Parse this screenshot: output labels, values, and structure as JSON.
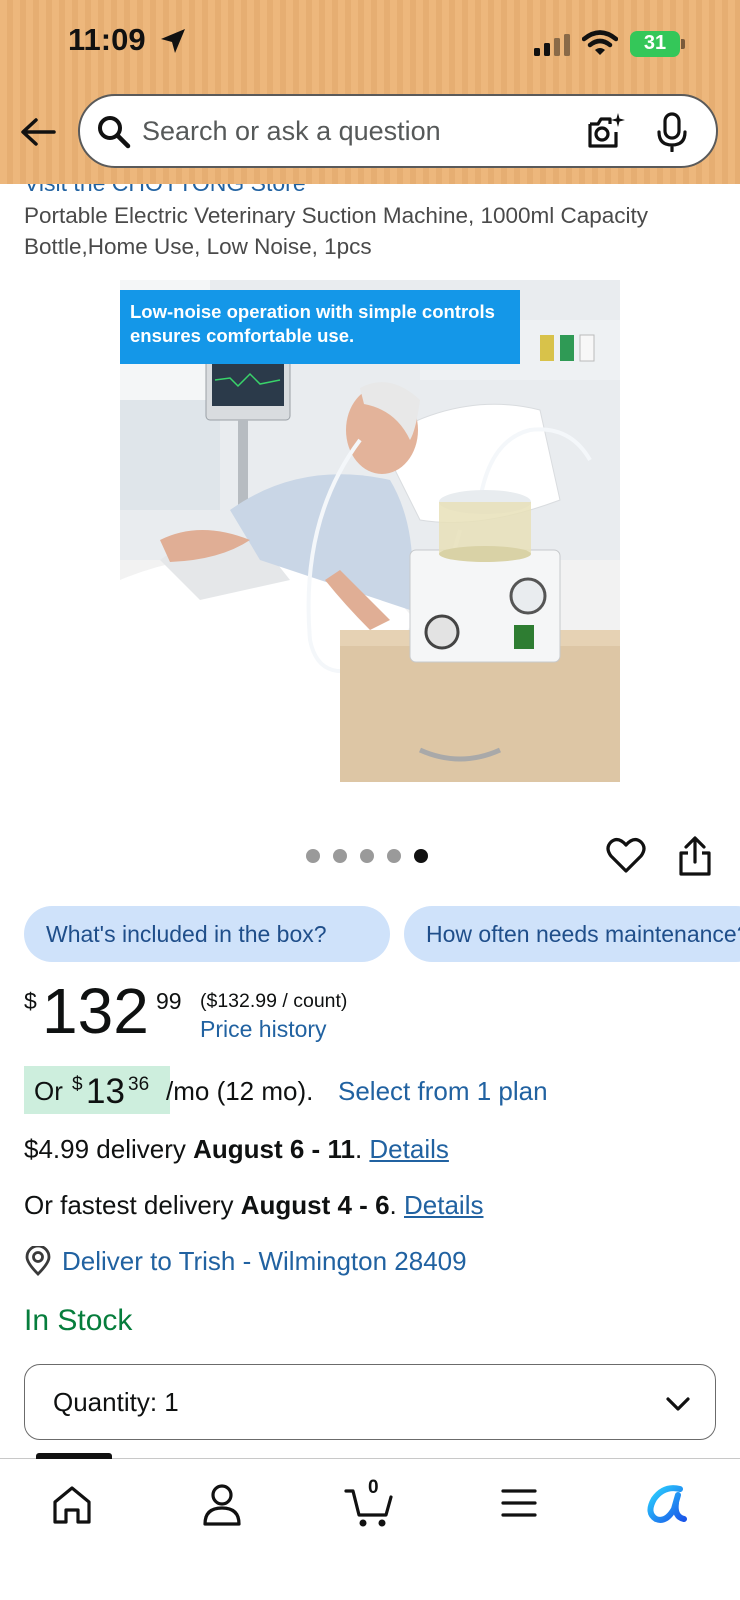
{
  "status_bar": {
    "time": "11:09",
    "battery": "31"
  },
  "search": {
    "placeholder": "Search or ask a question"
  },
  "product": {
    "store_link": "Visit the CHOYTONG Store",
    "title": "Portable Electric Veterinary Suction Machine, 1000ml Capacity Bottle,Home Use, Low Noise, 1pcs",
    "image_caption_line1": "Low-noise operation with simple controls",
    "image_caption_line2": "ensures comfortable use.",
    "image_count": 5,
    "active_image_index": 5
  },
  "questions": [
    {
      "label": "What's included in the box?"
    },
    {
      "label": "How often needs maintenance?"
    }
  ],
  "price": {
    "symbol": "$",
    "whole": "132",
    "fraction": "99",
    "unit_price": "($132.99 / count)",
    "history_link": "Price history"
  },
  "installment": {
    "prefix": "Or",
    "symbol": "$",
    "whole": "13",
    "cents": "36",
    "term": "/mo (12 mo).",
    "link": "Select from 1 plan"
  },
  "delivery": {
    "standard_prefix": "$4.99 delivery ",
    "standard_dates": "August 6 - 11",
    "fast_prefix": "Or fastest delivery ",
    "fast_dates": "August 4 - 6",
    "period": ".",
    "details_link": "Details",
    "deliver_to": "Deliver to Trish - Wilmington 28409"
  },
  "stock_status": "In Stock",
  "quantity": {
    "label": "Quantity:",
    "value": "1"
  },
  "cart": {
    "count": "0"
  },
  "colors": {
    "header_bg": "#edb77c",
    "link": "#2162a1",
    "in_stock": "#067d3c",
    "chip_bg": "#cfe2fa",
    "installment_bg": "#cdeedd",
    "caption_bg": "#1497e8"
  },
  "icons": [
    "location-arrow-icon",
    "signal-icon",
    "wifi-icon",
    "battery-icon",
    "back-arrow-icon",
    "search-icon",
    "camera-icon",
    "microphone-icon",
    "heart-icon",
    "share-icon",
    "location-pin-icon",
    "chevron-down-icon",
    "home-icon",
    "account-icon",
    "cart-icon",
    "menu-icon",
    "rufus-icon"
  ]
}
